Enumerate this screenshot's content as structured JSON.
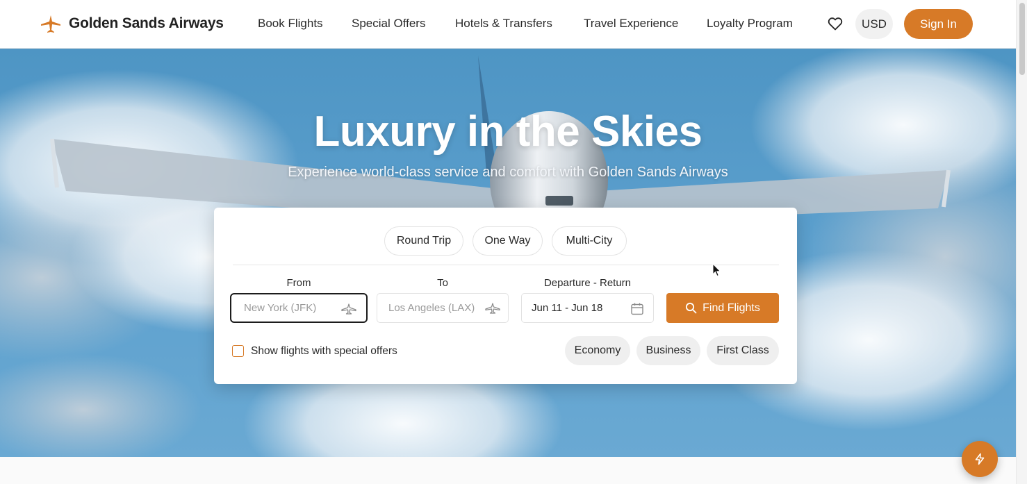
{
  "brand": {
    "name": "Golden Sands Airways",
    "accent_color": "#d77a27",
    "logo_icon": "plane-icon"
  },
  "nav": {
    "items": [
      {
        "label": "Book Flights"
      },
      {
        "label": "Special Offers"
      },
      {
        "label": "Hotels & Transfers"
      },
      {
        "label": "Travel Experience"
      },
      {
        "label": "Loyalty Program"
      }
    ],
    "wishlist_icon": "heart-icon",
    "currency": "USD",
    "sign_in": "Sign In"
  },
  "hero": {
    "title": "Luxury in the Skies",
    "subtitle": "Experience world-class service and comfort with Golden Sands Airways"
  },
  "search": {
    "trip_types": [
      "Round Trip",
      "One Way",
      "Multi-City"
    ],
    "from": {
      "label": "From",
      "placeholder": "New York (JFK)",
      "icon": "plane-icon"
    },
    "to": {
      "label": "To",
      "placeholder": "Los Angeles (LAX)",
      "icon": "plane-icon"
    },
    "dates": {
      "label": "Departure - Return",
      "value": "Jun 11 - Jun 18",
      "icon": "calendar-icon"
    },
    "submit": {
      "label": "Find Flights",
      "icon": "search-icon"
    },
    "special_offers_checkbox": {
      "label": "Show flights with special offers",
      "checked": false
    },
    "cabin_classes": [
      "Economy",
      "Business",
      "First Class"
    ]
  },
  "floating_action": {
    "icon": "lightning-icon"
  }
}
